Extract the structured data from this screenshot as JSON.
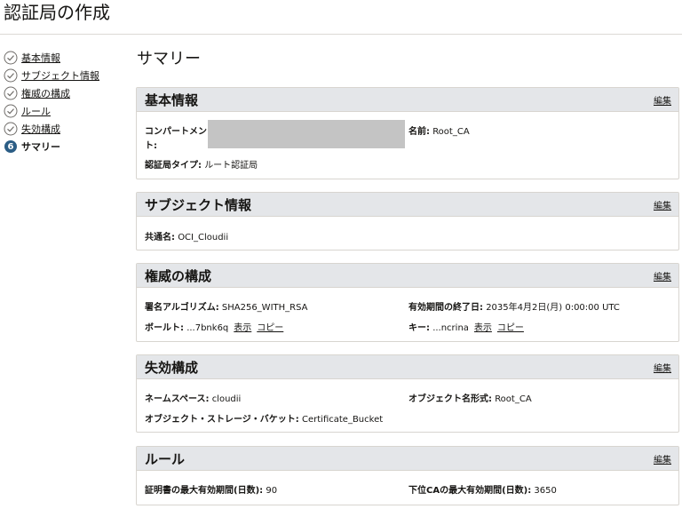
{
  "page": {
    "title": "認証局の作成"
  },
  "sidebar": {
    "steps": [
      {
        "label": "基本情報"
      },
      {
        "label": "サブジェクト情報"
      },
      {
        "label": "権威の構成"
      },
      {
        "label": "ルール"
      },
      {
        "label": "失効構成"
      },
      {
        "label": "サマリー",
        "number": "6"
      }
    ]
  },
  "summary": {
    "title": "サマリー",
    "edit_label": "編集",
    "basic": {
      "title": "基本情報",
      "compartment_label_1": "コンパートメン",
      "compartment_label_2": "ト:",
      "name_label": "名前:",
      "name_value": "Root_CA",
      "type_label": "認証局タイプ:",
      "type_value": "ルート認証局"
    },
    "subject": {
      "title": "サブジェクト情報",
      "cn_label": "共通名:",
      "cn_value": "OCI_Cloudii"
    },
    "authority": {
      "title": "権威の構成",
      "algo_label": "署名アルゴリズム:",
      "algo_value": "SHA256_WITH_RSA",
      "expiry_label": "有効期間の終了日:",
      "expiry_value": "2035年4月2日(月) 0:00:00 UTC",
      "vault_label": "ボールト:",
      "vault_value": "...7bnk6q",
      "key_label": "キー:",
      "key_value": "...ncrina",
      "show_label": "表示",
      "copy_label": "コピー"
    },
    "revocation": {
      "title": "失効構成",
      "ns_label": "ネームスペース:",
      "ns_value": "cloudii",
      "objname_label": "オブジェクト名形式:",
      "objname_value": "Root_CA",
      "bucket_label": "オブジェクト・ストレージ・バケット:",
      "bucket_value": "Certificate_Bucket"
    },
    "rules": {
      "title": "ルール",
      "max_label": "証明書の最大有効期間(日数):",
      "max_value": "90",
      "sub_label": "下位CAの最大有効期間(日数):",
      "sub_value": "3650"
    }
  }
}
